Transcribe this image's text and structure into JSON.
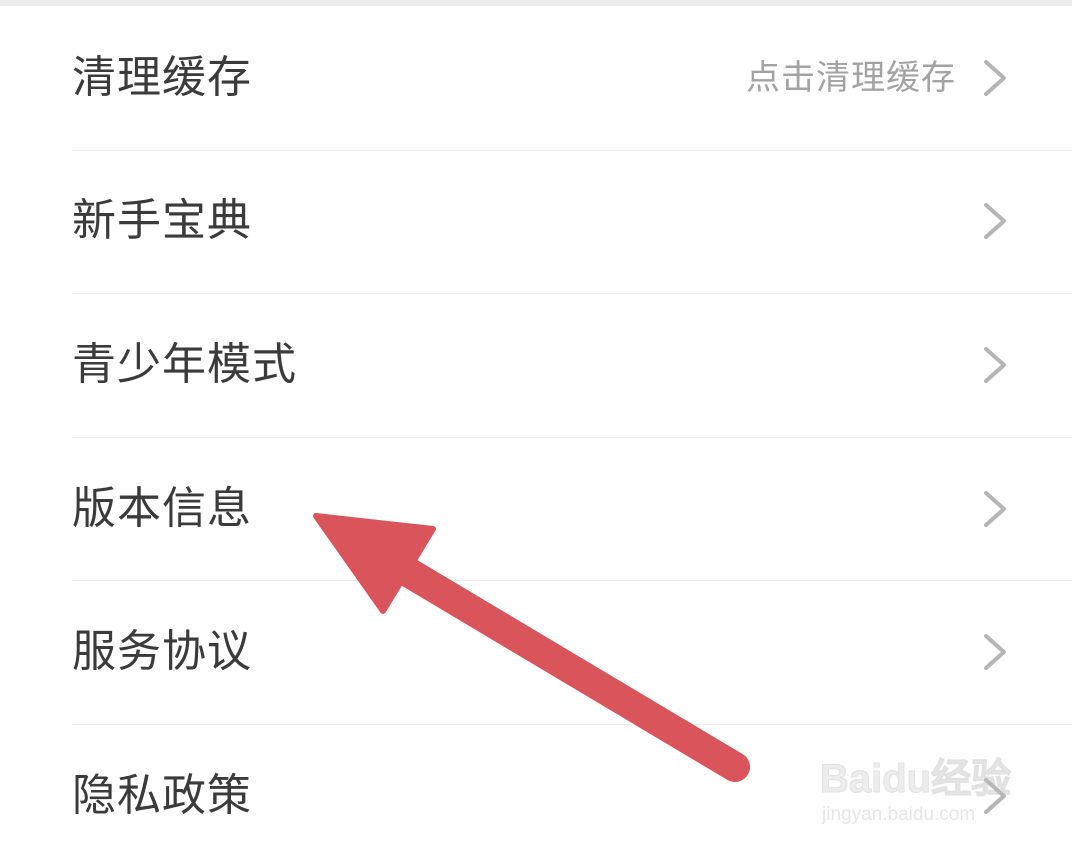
{
  "settings": {
    "items": [
      {
        "label": "清理缓存",
        "value": "点击清理缓存"
      },
      {
        "label": "新手宝典",
        "value": ""
      },
      {
        "label": "青少年模式",
        "value": ""
      },
      {
        "label": "版本信息",
        "value": ""
      },
      {
        "label": "服务协议",
        "value": ""
      },
      {
        "label": "隐私政策",
        "value": ""
      }
    ]
  },
  "annotation": {
    "type": "arrow",
    "color": "#d9545b",
    "points_to": "版本信息"
  },
  "watermark": {
    "brand": "Baidu经验",
    "url": "jingyan.baidu.com"
  },
  "icons": {
    "row_chevron": "chevron-right-icon"
  },
  "colors": {
    "background": "#ffffff",
    "label_text": "#3b3b3b",
    "value_text": "#a3a3a3",
    "chevron": "#b5b5b5",
    "divider": "#eeeeee",
    "arrow": "#d9545b"
  }
}
